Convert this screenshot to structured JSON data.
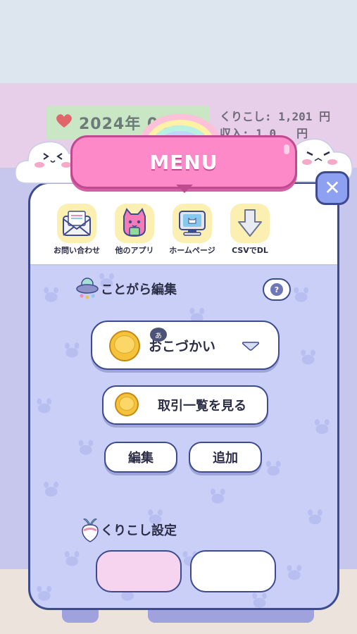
{
  "background": {
    "date_text": "2024年  09月",
    "carryover_label": "くりこし: 1,201 円",
    "income_label": "収入: 1,0__ 円"
  },
  "menu": {
    "title": "MENU",
    "close_symbol": "✕"
  },
  "shortcuts": [
    {
      "label": "お問い合わせ",
      "icon": "envelope-icon"
    },
    {
      "label": "他のアプリ",
      "icon": "pink-cat-icon"
    },
    {
      "label": "ホームページ",
      "icon": "computer-icon"
    },
    {
      "label": "CSVでDL",
      "icon": "download-arrow-icon"
    }
  ],
  "category_section": {
    "title": "ことがら編集",
    "help_symbol": "?",
    "selected_category": "おこづかい",
    "selected_badge": "あ",
    "view_list_label": "取引一覧を見る",
    "edit_label": "編集",
    "add_label": "追加"
  },
  "carryover_section": {
    "title": "くりこし設定"
  },
  "colors": {
    "menu_pink": "#fd89c9",
    "panel_lavender": "#c9cff7",
    "outline_navy": "#3d4a8e",
    "coin_gold": "#f5c33b",
    "icon_tile_yellow": "#fbefb1"
  }
}
